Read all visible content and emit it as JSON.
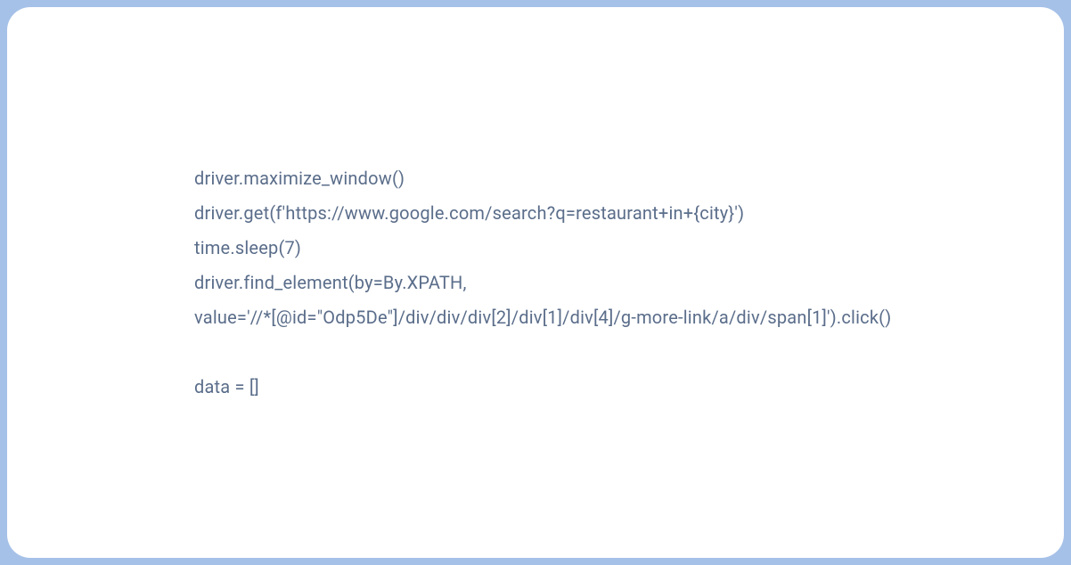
{
  "code": {
    "line1": "driver.maximize_window()",
    "line2": "driver.get(f'https://www.google.com/search?q=restaurant+in+{city}')",
    "line3": "time.sleep(7)",
    "line4": "driver.find_element(by=By.XPATH,",
    "line5": "value='//*[@id=\"Odp5De\"]/div/div/div[2]/div[1]/div[4]/g-more-link/a/div/span[1]').click()",
    "line6": "data = []"
  }
}
